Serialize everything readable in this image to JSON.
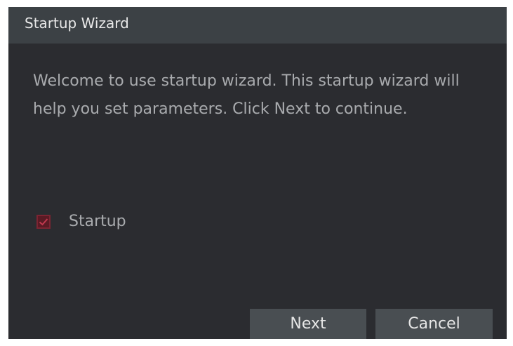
{
  "dialog": {
    "title": "Startup Wizard",
    "message": "Welcome to use startup wizard. This startup wizard will help you set parameters. Click Next to continue.",
    "checkbox": {
      "label": "Startup",
      "checked": true
    },
    "buttons": {
      "next_label": "Next",
      "cancel_label": "Cancel"
    }
  },
  "colors": {
    "dialog_background": "#2b2c30",
    "titlebar_background": "#3c4145",
    "button_background": "#494e52",
    "checkbox_accent": "#7c2432",
    "body_text": "#a9abae",
    "title_text": "#e8e8e8"
  },
  "icons": {
    "checkbox_mark": "checkmark-icon"
  }
}
